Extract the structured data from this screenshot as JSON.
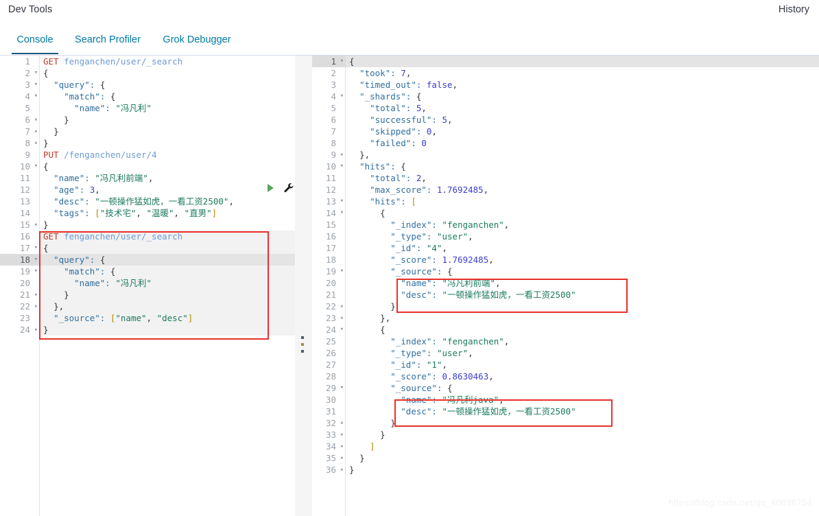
{
  "header": {
    "title": "Dev Tools",
    "history_label": "History"
  },
  "tabs": [
    {
      "label": "Console",
      "active": true
    },
    {
      "label": "Search Profiler",
      "active": false
    },
    {
      "label": "Grok Debugger",
      "active": false
    }
  ],
  "request_editor": {
    "name": "console-request-editor",
    "active_line": 18,
    "lines": [
      {
        "n": 1,
        "fold": "",
        "text": "GET fenganchen/user/_search"
      },
      {
        "n": 2,
        "fold": "▾",
        "text": "{"
      },
      {
        "n": 3,
        "fold": "▾",
        "text": "  \"query\": {"
      },
      {
        "n": 4,
        "fold": "▾",
        "text": "    \"match\": {"
      },
      {
        "n": 5,
        "fold": "",
        "text": "      \"name\": \"冯凡利\""
      },
      {
        "n": 6,
        "fold": "▴",
        "text": "    }"
      },
      {
        "n": 7,
        "fold": "▴",
        "text": "  }"
      },
      {
        "n": 8,
        "fold": "▴",
        "text": "}"
      },
      {
        "n": 9,
        "fold": "",
        "text": "PUT /fenganchen/user/4"
      },
      {
        "n": 10,
        "fold": "▾",
        "text": "{"
      },
      {
        "n": 11,
        "fold": "",
        "text": "  \"name\": \"冯凡利前端\","
      },
      {
        "n": 12,
        "fold": "",
        "text": "  \"age\": 3,"
      },
      {
        "n": 13,
        "fold": "",
        "text": "  \"desc\": \"一顿操作猛如虎，一看工资2500\","
      },
      {
        "n": 14,
        "fold": "",
        "text": "  \"tags\": [\"技术宅\", \"温暖\", \"直男\"]"
      },
      {
        "n": 15,
        "fold": "▴",
        "text": "}"
      },
      {
        "n": 16,
        "fold": "",
        "text": "GET fenganchen/user/_search"
      },
      {
        "n": 17,
        "fold": "▾",
        "text": "{"
      },
      {
        "n": 18,
        "fold": "▾",
        "text": "  \"query\": {"
      },
      {
        "n": 19,
        "fold": "▾",
        "text": "    \"match\": {"
      },
      {
        "n": 20,
        "fold": "",
        "text": "      \"name\": \"冯凡利\""
      },
      {
        "n": 21,
        "fold": "▴",
        "text": "    }"
      },
      {
        "n": 22,
        "fold": "▴",
        "text": "  },"
      },
      {
        "n": 23,
        "fold": "",
        "text": "  \"_source\": [\"name\", \"desc\"]"
      },
      {
        "n": 24,
        "fold": "▴",
        "text": "}"
      }
    ]
  },
  "response_editor": {
    "name": "console-response-viewer",
    "active_line": 1,
    "lines": [
      {
        "n": 1,
        "fold": "▾",
        "text": "{"
      },
      {
        "n": 2,
        "fold": "",
        "text": "  \"took\": 7,"
      },
      {
        "n": 3,
        "fold": "",
        "text": "  \"timed_out\": false,"
      },
      {
        "n": 4,
        "fold": "▾",
        "text": "  \"_shards\": {"
      },
      {
        "n": 5,
        "fold": "",
        "text": "    \"total\": 5,"
      },
      {
        "n": 6,
        "fold": "",
        "text": "    \"successful\": 5,"
      },
      {
        "n": 7,
        "fold": "",
        "text": "    \"skipped\": 0,"
      },
      {
        "n": 8,
        "fold": "",
        "text": "    \"failed\": 0"
      },
      {
        "n": 9,
        "fold": "▴",
        "text": "  },"
      },
      {
        "n": 10,
        "fold": "▾",
        "text": "  \"hits\": {"
      },
      {
        "n": 11,
        "fold": "",
        "text": "    \"total\": 2,"
      },
      {
        "n": 12,
        "fold": "",
        "text": "    \"max_score\": 1.7692485,"
      },
      {
        "n": 13,
        "fold": "▾",
        "text": "    \"hits\": ["
      },
      {
        "n": 14,
        "fold": "▾",
        "text": "      {"
      },
      {
        "n": 15,
        "fold": "",
        "text": "        \"_index\": \"fenganchen\","
      },
      {
        "n": 16,
        "fold": "",
        "text": "        \"_type\": \"user\","
      },
      {
        "n": 17,
        "fold": "",
        "text": "        \"_id\": \"4\","
      },
      {
        "n": 18,
        "fold": "",
        "text": "        \"_score\": 1.7692485,"
      },
      {
        "n": 19,
        "fold": "▾",
        "text": "        \"_source\": {"
      },
      {
        "n": 20,
        "fold": "",
        "text": "          \"name\": \"冯凡利前端\","
      },
      {
        "n": 21,
        "fold": "",
        "text": "          \"desc\": \"一顿操作猛如虎，一看工资2500\""
      },
      {
        "n": 22,
        "fold": "▴",
        "text": "        }"
      },
      {
        "n": 23,
        "fold": "▴",
        "text": "      },"
      },
      {
        "n": 24,
        "fold": "▾",
        "text": "      {"
      },
      {
        "n": 25,
        "fold": "",
        "text": "        \"_index\": \"fenganchen\","
      },
      {
        "n": 26,
        "fold": "",
        "text": "        \"_type\": \"user\","
      },
      {
        "n": 27,
        "fold": "",
        "text": "        \"_id\": \"1\","
      },
      {
        "n": 28,
        "fold": "",
        "text": "        \"_score\": 0.8630463,"
      },
      {
        "n": 29,
        "fold": "▾",
        "text": "        \"_source\": {"
      },
      {
        "n": 30,
        "fold": "",
        "text": "          \"name\": \"冯凡利java\","
      },
      {
        "n": 31,
        "fold": "",
        "text": "          \"desc\": \"一顿操作猛如虎，一看工资2500\""
      },
      {
        "n": 32,
        "fold": "▴",
        "text": "        }"
      },
      {
        "n": 33,
        "fold": "▴",
        "text": "      }"
      },
      {
        "n": 34,
        "fold": "▴",
        "text": "    ]"
      },
      {
        "n": 35,
        "fold": "▴",
        "text": "  }"
      },
      {
        "n": 36,
        "fold": "▴",
        "text": "}"
      }
    ]
  },
  "actions": {
    "play_icon": "play-triangle-icon",
    "wrench_icon": "wrench-icon"
  },
  "annotations": {
    "request_box": "highlighted-request-block",
    "hit1_box": "highlighted-source-hit-1",
    "hit2_box": "highlighted-source-hit-2",
    "accent_red": "#e8302a"
  },
  "watermark": {
    "text": "https://blog.csdn.net/qq_40036754"
  }
}
